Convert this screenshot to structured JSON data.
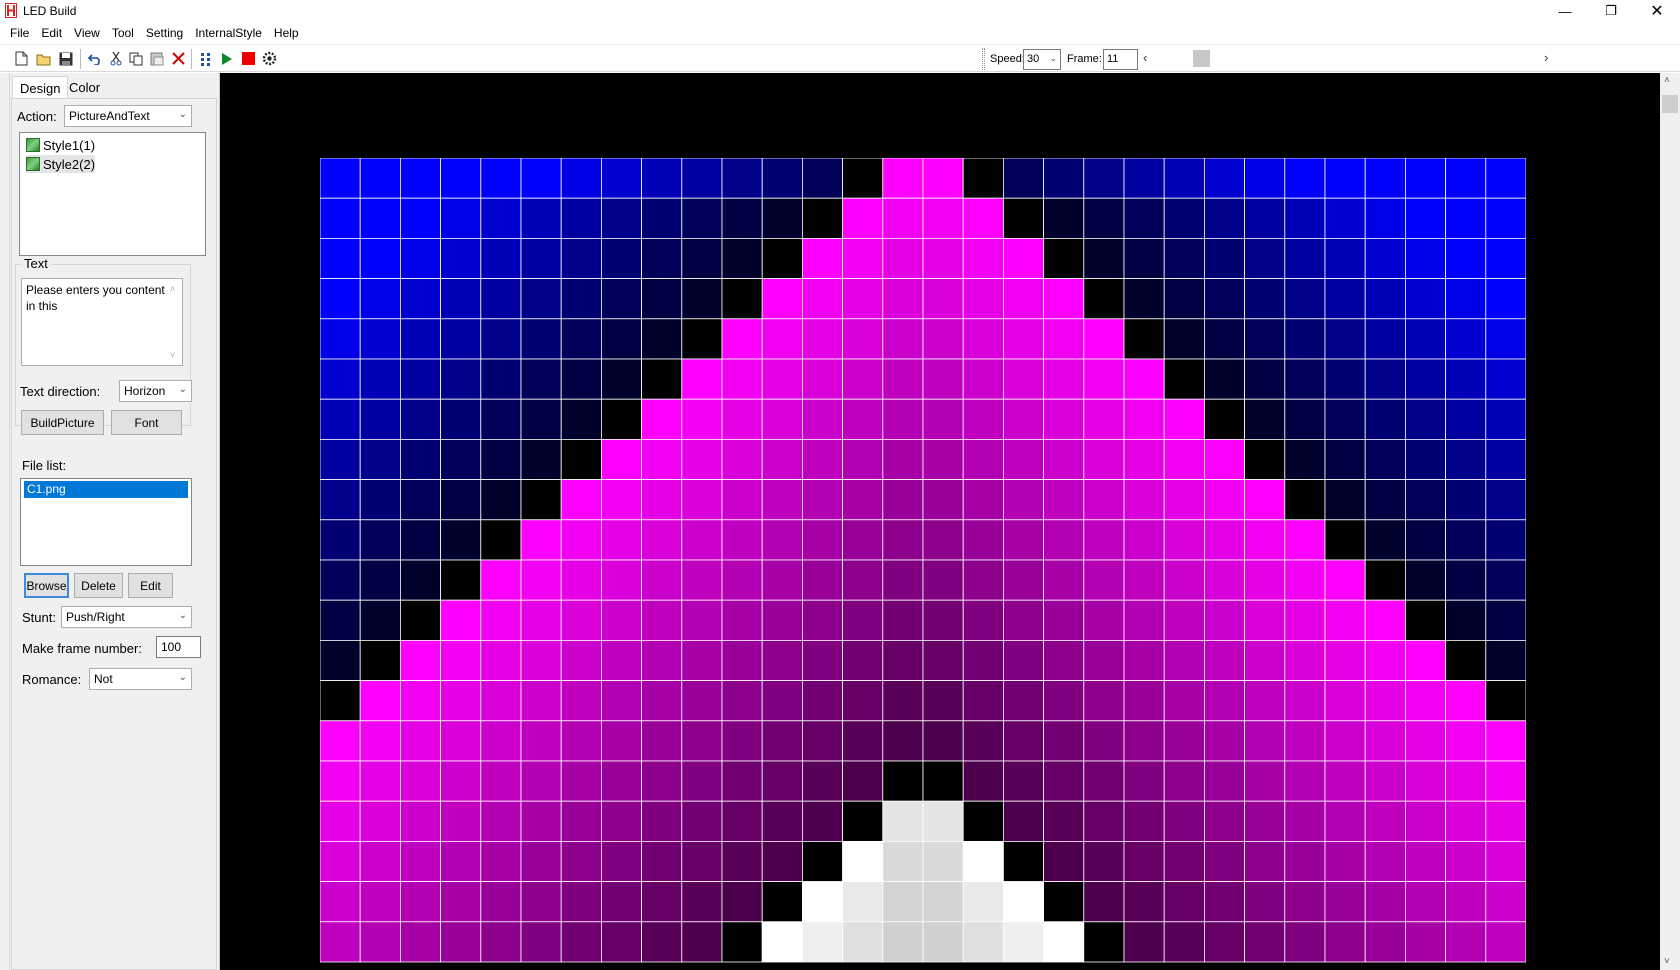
{
  "window": {
    "title": "LED Build"
  },
  "menu": [
    "File",
    "Edit",
    "View",
    "Tool",
    "Setting",
    "InternalStyle",
    "Help"
  ],
  "toolbar": {
    "speed_label": "Speed:",
    "speed_value": "30",
    "frame_label": "Frame:",
    "frame_value": "11",
    "icons": [
      "new-file-icon",
      "open-folder-icon",
      "save-icon",
      "undo-icon",
      "cut-icon",
      "copy-icon",
      "paste-icon",
      "delete-icon",
      "grid-icon",
      "play-icon",
      "stop-icon",
      "settings-gear-icon"
    ]
  },
  "panel": {
    "tabs": [
      "Design",
      "Color"
    ],
    "action_label": "Action:",
    "action_value": "PictureAndText",
    "styles": [
      "Style1(1)",
      "Style2(2)"
    ],
    "text_group_label": "Text",
    "text_content": "Please enters you content in this",
    "text_direction_label": "Text direction:",
    "text_direction_value": "Horizon",
    "build_picture_button": "BuildPicture",
    "font_button": "Font",
    "file_list_label": "File list:",
    "files": [
      "C1.png"
    ],
    "browse_button": "Browse",
    "delete_button": "Delete",
    "edit_button": "Edit",
    "stunt_label": "Stunt:",
    "stunt_value": "Push/Right",
    "make_frame_label": "Make frame number:",
    "make_frame_value": "100",
    "romance_label": "Romance:",
    "romance_value": "Not"
  },
  "led": {
    "columns": 30,
    "visible_rows": 20,
    "colors": {
      "background_blue": "#0000ff",
      "magenta": "#ff00ff",
      "black": "#000000",
      "white": "#ffffff",
      "gridline": "#ffffff"
    }
  }
}
